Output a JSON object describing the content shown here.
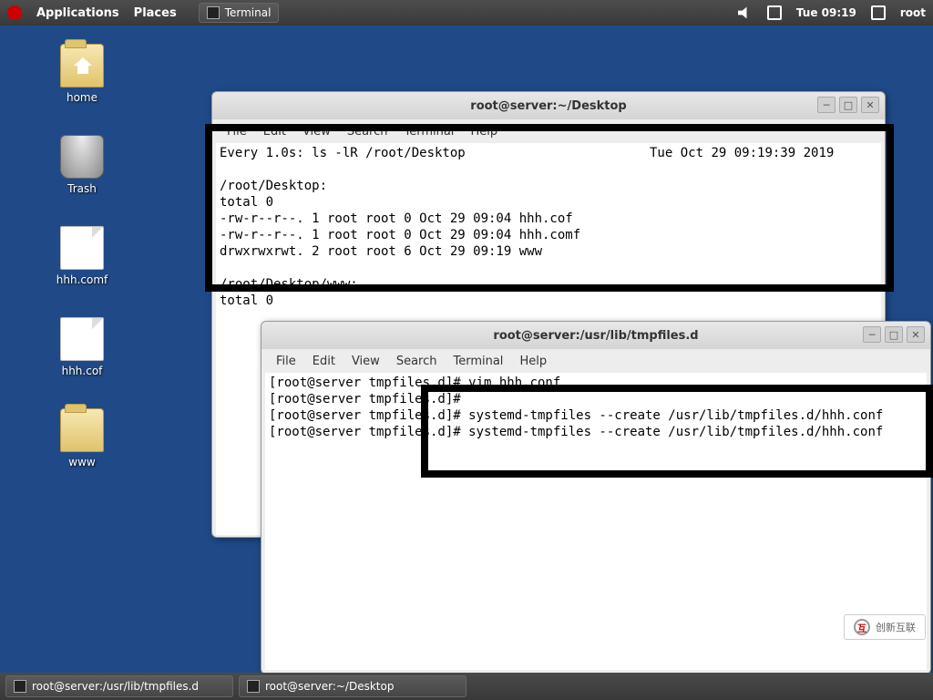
{
  "panel": {
    "applications": "Applications",
    "places": "Places",
    "task_terminal": "Terminal",
    "clock": "Tue 09:19",
    "user": "root"
  },
  "desktop_icons": {
    "home": "home",
    "trash": "Trash",
    "file1": "hhh.comf",
    "file2": "hhh.cof",
    "folder_www": "www"
  },
  "window_back": {
    "title": "root@server:~/Desktop",
    "content": "Every 1.0s: ls -lR /root/Desktop                        Tue Oct 29 09:19:39 2019\n\n/root/Desktop:\ntotal 0\n-rw-r--r--. 1 root root 0 Oct 29 09:04 hhh.cof\n-rw-r--r--. 1 root root 0 Oct 29 09:04 hhh.comf\ndrwxrwxrwt. 2 root root 6 Oct 29 09:19 www\n\n/root/Desktop/www:\ntotal 0"
  },
  "window_front": {
    "title": "root@server:/usr/lib/tmpfiles.d",
    "menu": {
      "file": "File",
      "edit": "Edit",
      "view": "View",
      "search": "Search",
      "terminal": "Terminal",
      "help": "Help"
    },
    "content": "[root@server tmpfiles.d]# vim hhh.conf\n[root@server tmpfiles.d]# \n[root@server tmpfiles.d]# systemd-tmpfiles --create /usr/lib/tmpfiles.d/hhh.conf\n[root@server tmpfiles.d]# systemd-tmpfiles --create /usr/lib/tmpfiles.d/hhh.conf"
  },
  "taskbar": {
    "task1": "root@server:/usr/lib/tmpfiles.d",
    "task2": "root@server:~/Desktop"
  },
  "watermark": "创新互联"
}
